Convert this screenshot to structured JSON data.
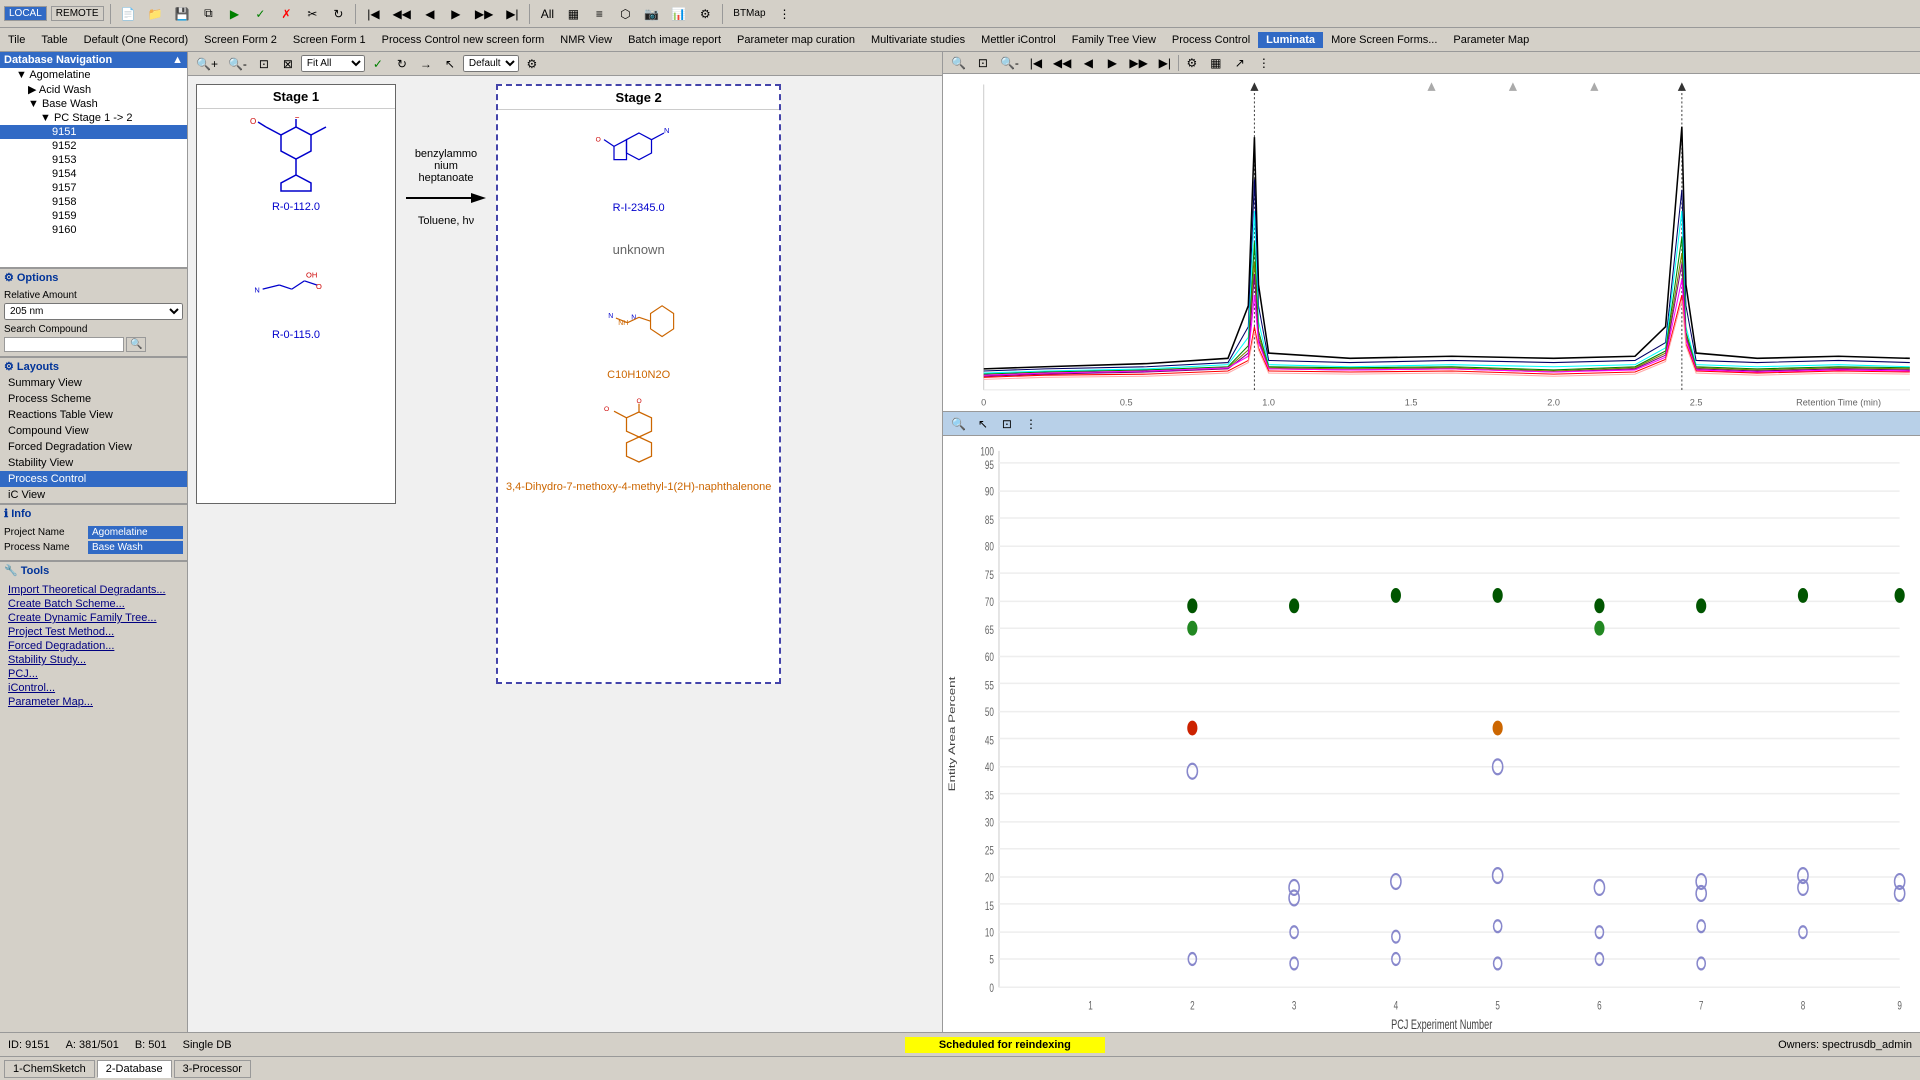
{
  "app": {
    "local_btn": "LOCAL",
    "remote_btn": "REMOTE"
  },
  "menubar": {
    "items": [
      {
        "label": "Tile",
        "active": false
      },
      {
        "label": "Table",
        "active": false
      },
      {
        "label": "Default (One Record)",
        "active": false
      },
      {
        "label": "Screen Form 2",
        "active": false
      },
      {
        "label": "Screen Form 1",
        "active": false
      },
      {
        "label": "Process Control new screen form",
        "active": false
      },
      {
        "label": "NMR View",
        "active": false
      },
      {
        "label": "Batch image report",
        "active": false
      },
      {
        "label": "Parameter map curation",
        "active": false
      },
      {
        "label": "Multivariate studies",
        "active": false
      },
      {
        "label": "Mettler iControl",
        "active": false
      },
      {
        "label": "Family Tree View",
        "active": false
      },
      {
        "label": "Process Control",
        "active": false
      },
      {
        "label": "Luminata",
        "active": true
      },
      {
        "label": "More Screen Forms...",
        "active": false
      },
      {
        "label": "Parameter Map",
        "active": false
      }
    ]
  },
  "db_nav": {
    "header": "Database Navigation",
    "tree": [
      {
        "label": "Agomelatine",
        "level": 1,
        "expanded": true
      },
      {
        "label": "Acid Wash",
        "level": 2,
        "expanded": false
      },
      {
        "label": "Base Wash",
        "level": 2,
        "expanded": true
      },
      {
        "label": "PC Stage 1 -> 2",
        "level": 3,
        "expanded": true
      },
      {
        "label": "9151",
        "level": 4,
        "selected": true
      },
      {
        "label": "9152",
        "level": 4
      },
      {
        "label": "9153",
        "level": 4
      },
      {
        "label": "9154",
        "level": 4
      },
      {
        "label": "9157",
        "level": 4
      },
      {
        "label": "9158",
        "level": 4
      },
      {
        "label": "9159",
        "level": 4
      },
      {
        "label": "9160",
        "level": 4
      }
    ]
  },
  "options": {
    "header": "Options",
    "relative_amount_label": "Relative Amount",
    "relative_amount_value": "205 nm",
    "search_compound_label": "Search Compound",
    "search_placeholder": ""
  },
  "layouts": {
    "header": "Layouts",
    "items": [
      {
        "label": "Summary View"
      },
      {
        "label": "Process Scheme"
      },
      {
        "label": "Reactions Table View"
      },
      {
        "label": "Compound View"
      },
      {
        "label": "Forced Degradation View"
      },
      {
        "label": "Stability View"
      },
      {
        "label": "Process Control",
        "active": true
      },
      {
        "label": "iC View"
      }
    ]
  },
  "info": {
    "header": "Info",
    "project_name_label": "Project Name",
    "project_name_value": "Agomelatine",
    "process_name_label": "Process Name",
    "process_name_value": "Base Wash"
  },
  "tools": {
    "header": "Tools",
    "items": [
      {
        "label": "Import Theoretical Degradants..."
      },
      {
        "label": "Create Batch Scheme..."
      },
      {
        "label": "Create Dynamic Family Tree..."
      },
      {
        "label": "Project Test Method..."
      },
      {
        "label": "Forced Degradation..."
      },
      {
        "label": "Stability Study..."
      },
      {
        "label": "PCJ..."
      },
      {
        "label": "iControl..."
      },
      {
        "label": "Parameter Map..."
      }
    ]
  },
  "stage1": {
    "header": "Stage 1",
    "compound1_label": "R-0-112.0",
    "compound2_label": "R-0-115.0"
  },
  "stage2": {
    "header": "Stage 2",
    "compound1_label": "R-I-2345.0",
    "unknown_label": "unknown",
    "compound3_formula": "C10H10N2O",
    "compound4_label": "3,4-Dihydro-7-methoxy-4-methyl-1(2H)-naphthalenone"
  },
  "reaction": {
    "reagent1": "benzylammonium heptanoate",
    "reagent2": "Toluene, hv"
  },
  "statusbar": {
    "id_label": "ID: 9151",
    "a_label": "A: 381/501",
    "b_label": "B: 501",
    "db_label": "Single DB",
    "status_label": "Scheduled for reindexing",
    "owners_label": "Owners: spectrusdb_admin"
  },
  "bottom_tabs": [
    {
      "label": "1-ChemSketch",
      "active": false
    },
    {
      "label": "2-Database",
      "active": true
    },
    {
      "label": "3-Processor",
      "active": false
    }
  ],
  "scatter": {
    "x_label": "PCJ Experiment Number",
    "y_label": "Entity Area Percent",
    "y_ticks": [
      0,
      5,
      10,
      15,
      20,
      25,
      30,
      35,
      40,
      45,
      50,
      55,
      60,
      65,
      70,
      75,
      80,
      85,
      90,
      95,
      100
    ],
    "x_ticks": [
      1,
      2,
      3,
      4,
      5,
      6,
      7,
      8,
      9
    ]
  }
}
